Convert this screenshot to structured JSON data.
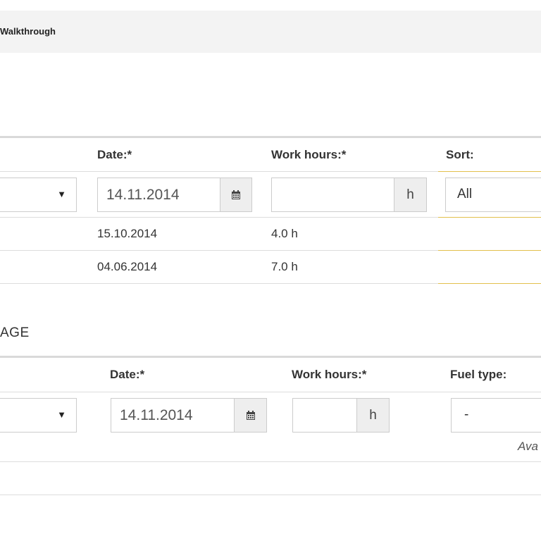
{
  "header": {
    "title": "Walkthrough"
  },
  "section1": {
    "columns": {
      "date": "Date:*",
      "work_hours": "Work hours:*",
      "sort": "Sort:"
    },
    "form": {
      "date_value": "14.11.2014",
      "hours_value": "",
      "hours_unit": "h",
      "sort_value": "All"
    },
    "rows": [
      {
        "date": "15.10.2014",
        "hours": "4.0 h"
      },
      {
        "date": "04.06.2014",
        "hours": "7.0 h"
      }
    ],
    "icons": {
      "select_caret": "caret-down-icon",
      "calendar": "calendar-icon"
    }
  },
  "section2": {
    "title": "AGE",
    "columns": {
      "date": "Date:*",
      "work_hours": "Work hours:*",
      "fuel_type": "Fuel type:"
    },
    "form": {
      "date_value": "14.11.2014",
      "hours_value": "",
      "hours_unit": "h",
      "fuel_value": "-"
    },
    "hint": "Ava"
  },
  "colors": {
    "accent_line": "#e2c04c",
    "topbar_bg": "#f3f3f3",
    "border": "#cccccc"
  }
}
